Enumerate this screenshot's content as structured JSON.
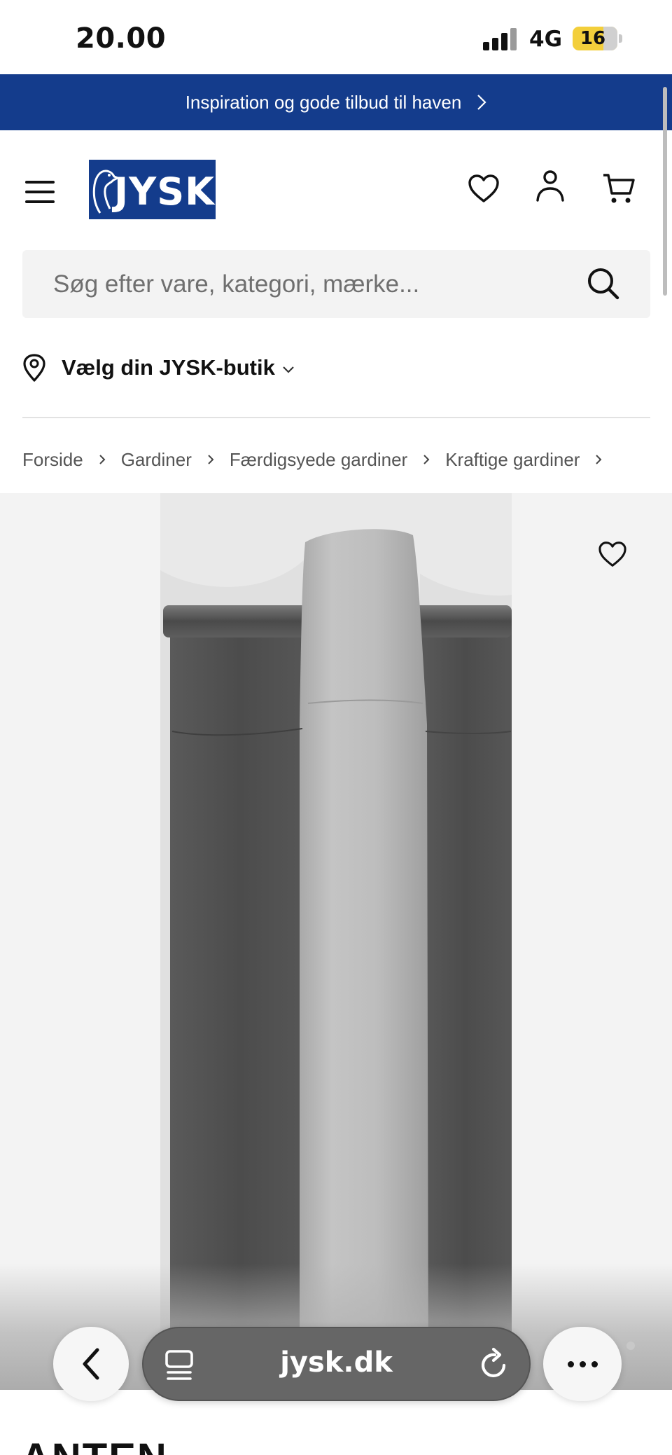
{
  "status_bar": {
    "time": "20.00",
    "network": "4G",
    "battery": "16"
  },
  "promo": {
    "text": "Inspiration og gode tilbud til haven"
  },
  "header": {
    "logo": "JYSK"
  },
  "search": {
    "placeholder": "Søg efter vare, kategori, mærke..."
  },
  "store": {
    "label": "Vælg din JYSK-butik"
  },
  "breadcrumb": {
    "items": [
      "Forside",
      "Gardiner",
      "Færdigsyede gardiner",
      "Kraftige gardiner"
    ]
  },
  "browser": {
    "url": "jysk.dk"
  },
  "product": {
    "title_partial": "ANTEN"
  },
  "colors": {
    "brand_blue": "#143c8c",
    "page_bg": "#ffffff",
    "image_bg": "#f3f3f3"
  },
  "icons": [
    "menu-icon",
    "heart-icon",
    "user-icon",
    "cart-icon",
    "search-icon",
    "location-pin-icon",
    "chevron-down-icon",
    "chevron-right-icon",
    "back-arrow-icon",
    "tabs-icon",
    "reload-icon",
    "more-icon"
  ]
}
